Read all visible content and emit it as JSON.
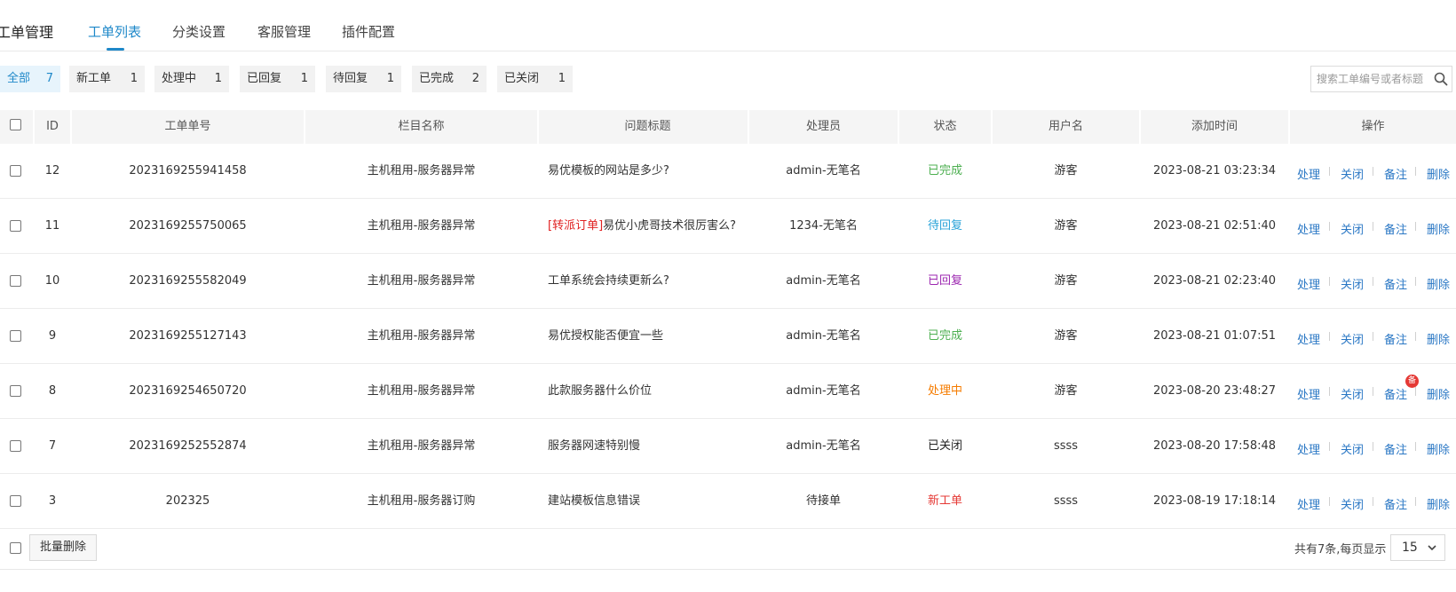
{
  "header": {
    "title": "工单管理",
    "tabs": [
      {
        "label": "工单列表",
        "active": true
      },
      {
        "label": "分类设置",
        "active": false
      },
      {
        "label": "客服管理",
        "active": false
      },
      {
        "label": "插件配置",
        "active": false
      }
    ]
  },
  "filters": [
    {
      "label": "全部",
      "count": "7",
      "active": true
    },
    {
      "label": "新工单",
      "count": "1",
      "active": false
    },
    {
      "label": "处理中",
      "count": "1",
      "active": false
    },
    {
      "label": "已回复",
      "count": "1",
      "active": false
    },
    {
      "label": "待回复",
      "count": "1",
      "active": false
    },
    {
      "label": "已完成",
      "count": "2",
      "active": false
    },
    {
      "label": "已关闭",
      "count": "1",
      "active": false
    }
  ],
  "search": {
    "placeholder": "搜索工单编号或者标题",
    "icon": "search-icon"
  },
  "table": {
    "headers": [
      "ID",
      "工单单号",
      "栏目名称",
      "问题标题",
      "处理员",
      "状态",
      "用户名",
      "添加时间",
      "操作"
    ],
    "actions": [
      "处理",
      "关闭",
      "备注",
      "删除"
    ],
    "rows": [
      {
        "id": "12",
        "order_no": "2023169255941458",
        "category": "主机租用-服务器异常",
        "tag": "",
        "title": "易优模板的网站是多少?",
        "handler": "admin-无笔名",
        "status": "已完成",
        "status_class": "status-done",
        "user": "游客",
        "time": "2023-08-21 03:23:34",
        "note_badge": ""
      },
      {
        "id": "11",
        "order_no": "2023169255750065",
        "category": "主机租用-服务器异常",
        "tag": "[转派订单]",
        "title": "易优小虎哥技术很厉害么?",
        "handler": "1234-无笔名",
        "status": "待回复",
        "status_class": "status-wait",
        "user": "游客",
        "time": "2023-08-21 02:51:40",
        "note_badge": ""
      },
      {
        "id": "10",
        "order_no": "2023169255582049",
        "category": "主机租用-服务器异常",
        "tag": "",
        "title": "工单系统会持续更新么?",
        "handler": "admin-无笔名",
        "status": "已回复",
        "status_class": "status-replied",
        "user": "游客",
        "time": "2023-08-21 02:23:40",
        "note_badge": ""
      },
      {
        "id": "9",
        "order_no": "2023169255127143",
        "category": "主机租用-服务器异常",
        "tag": "",
        "title": "易优授权能否便宜一些",
        "handler": "admin-无笔名",
        "status": "已完成",
        "status_class": "status-done",
        "user": "游客",
        "time": "2023-08-21 01:07:51",
        "note_badge": ""
      },
      {
        "id": "8",
        "order_no": "2023169254650720",
        "category": "主机租用-服务器异常",
        "tag": "",
        "title": "此款服务器什么价位",
        "handler": "admin-无笔名",
        "status": "处理中",
        "status_class": "status-progress",
        "user": "游客",
        "time": "2023-08-20 23:48:27",
        "note_badge": "备"
      },
      {
        "id": "7",
        "order_no": "2023169252552874",
        "category": "主机租用-服务器异常",
        "tag": "",
        "title": "服务器网速特别慢",
        "handler": "admin-无笔名",
        "status": "已关闭",
        "status_class": "status-closed",
        "user": "ssss",
        "time": "2023-08-20 17:58:48",
        "note_badge": ""
      },
      {
        "id": "3",
        "order_no": "202325",
        "category": "主机租用-服务器订购",
        "tag": "",
        "title": "建站模板信息错误",
        "handler": "待接单",
        "status": "新工单",
        "status_class": "status-new",
        "user": "ssss",
        "time": "2023-08-19 17:18:14",
        "note_badge": ""
      }
    ]
  },
  "footer": {
    "batch_delete": "批量删除",
    "summary": "共有7条,每页显示",
    "page_size": "15"
  },
  "colors": {
    "accent": "#1e88c9",
    "link": "#2b78c5"
  }
}
